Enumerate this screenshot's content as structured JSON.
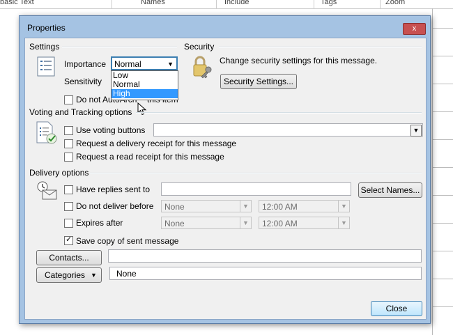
{
  "background": {
    "columns": [
      "basic Text",
      "Names",
      "Include",
      "Tags",
      "Zoom"
    ]
  },
  "dialog": {
    "title": "Properties",
    "close_glyph": "x"
  },
  "settings": {
    "section_label": "Settings",
    "importance_label": "Importance",
    "importance_value": "Normal",
    "importance_options": [
      "Low",
      "Normal",
      "High"
    ],
    "importance_highlighted": "High",
    "sensitivity_label": "Sensitivity",
    "do_not_autoarchive_label_visible_a": "Do not AutoArch",
    "do_not_autoarchive_label_visible_b": "this item"
  },
  "security": {
    "section_label": "Security",
    "description": "Change security settings for this message.",
    "button_label": "Security Settings..."
  },
  "voting": {
    "section_label": "Voting and Tracking options",
    "use_voting_buttons_label": "Use voting buttons",
    "delivery_receipt_label": "Request a delivery receipt for this message",
    "read_receipt_label": "Request a read receipt for this message"
  },
  "delivery": {
    "section_label": "Delivery options",
    "have_replies_label": "Have replies sent to",
    "select_names_button": "Select Names...",
    "do_not_deliver_label": "Do not deliver before",
    "do_not_deliver_date": "None",
    "do_not_deliver_time": "12:00 AM",
    "expires_label": "Expires after",
    "expires_date": "None",
    "expires_time": "12:00 AM",
    "save_copy_label": "Save copy of sent message",
    "save_copy_checked": true
  },
  "contacts": {
    "button_label": "Contacts...",
    "value": ""
  },
  "categories": {
    "button_label": "Categories",
    "value": "None"
  },
  "footer": {
    "close_button": "Close"
  }
}
